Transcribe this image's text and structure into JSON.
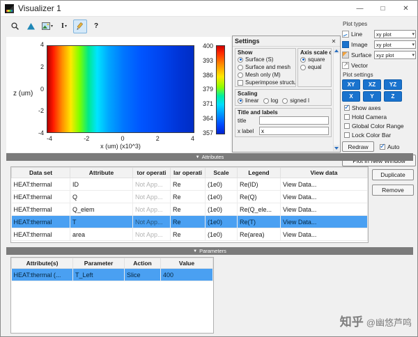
{
  "window": {
    "title": "Visualizer 1"
  },
  "titlebar": {
    "minimize": "—",
    "maximize": "□",
    "close": "✕"
  },
  "toolbar": {
    "text_tool": "I",
    "help": "?"
  },
  "section_glyph": "▼",
  "plot": {
    "ylabel": "z (um)",
    "xlabel": "x (um) (x10^3)",
    "yticks": [
      "4",
      "2",
      "0",
      "-2",
      "-4"
    ],
    "xticks": [
      "-4",
      "-2",
      "0",
      "2",
      "4"
    ],
    "colorbar_ticks": [
      "400",
      "393",
      "386",
      "379",
      "371",
      "364",
      "357"
    ]
  },
  "settings": {
    "title": "Settings",
    "close": "✕",
    "show": {
      "label": "Show",
      "radios": [
        {
          "label": "Surface (S)",
          "selected": true
        },
        {
          "label": "Surface and mesh",
          "selected": false
        },
        {
          "label": "Mesh only (M)",
          "selected": false
        }
      ],
      "superimpose": {
        "label": "Superimpose structure",
        "checked": false
      }
    },
    "axis_scale": {
      "label": "Axis scale opt",
      "radios": [
        {
          "label": "square",
          "selected": true
        },
        {
          "label": "equal",
          "selected": false
        }
      ]
    },
    "scaling": {
      "label": "Scaling",
      "radios": [
        {
          "label": "linear",
          "selected": true
        },
        {
          "label": "log",
          "selected": false
        },
        {
          "label": "signed l",
          "selected": false
        }
      ]
    },
    "labels_group": {
      "label": "Title and labels",
      "fields": [
        {
          "label": "title",
          "value": ""
        },
        {
          "label": "x label",
          "value": "x"
        }
      ]
    }
  },
  "plot_types": {
    "label": "Plot types",
    "rows": [
      {
        "label": "Line",
        "dropdown": "xy plot",
        "selected": false
      },
      {
        "label": "Image",
        "dropdown": "xy plot",
        "selected": true
      },
      {
        "label": "Surface",
        "dropdown": "xyz plot",
        "selected": false
      },
      {
        "label": "Vector",
        "dropdown": "",
        "selected": false
      }
    ]
  },
  "plot_settings": {
    "label": "Plot settings",
    "buttons_row1": [
      "XY",
      "XZ",
      "YZ"
    ],
    "buttons_row2": [
      "X",
      "Y",
      "Z"
    ],
    "checkboxes": [
      {
        "label": "Show axes",
        "checked": true
      },
      {
        "label": "Hold Camera",
        "checked": false
      },
      {
        "label": "Global Color Range",
        "checked": false
      },
      {
        "label": "Lock Color Bar",
        "checked": false
      }
    ],
    "redraw": "Redraw",
    "auto": {
      "label": "Auto",
      "checked": true
    },
    "plot_new_window": "Plot in New Window"
  },
  "attributes": {
    "header": "Attributes",
    "columns": [
      "Data set",
      "Attribute",
      "tor operati",
      "lar operati",
      "Scale",
      "Legend",
      "View data"
    ],
    "rows": [
      {
        "dataset": "HEAT:thermal",
        "attribute": "ID",
        "vector_op": "Not App...",
        "scalar_op": "Re",
        "scale": "(1e0)",
        "legend": "Re(ID)",
        "view": "View Data...",
        "selected": false
      },
      {
        "dataset": "HEAT:thermal",
        "attribute": "Q",
        "vector_op": "Not App...",
        "scalar_op": "Re",
        "scale": "(1e0)",
        "legend": "Re(Q)",
        "view": "View Data...",
        "selected": false
      },
      {
        "dataset": "HEAT:thermal",
        "attribute": "Q_elem",
        "vector_op": "Not App...",
        "scalar_op": "Re",
        "scale": "(1e0)",
        "legend": "Re(Q_ele...",
        "view": "View Data...",
        "selected": false
      },
      {
        "dataset": "HEAT:thermal",
        "attribute": "T",
        "vector_op": "Not App...",
        "scalar_op": "Re",
        "scale": "(1e0)",
        "legend": "Re(T)",
        "view": "View Data...",
        "selected": true
      },
      {
        "dataset": "HEAT:thermal",
        "attribute": "area",
        "vector_op": "Not App...",
        "scalar_op": "Re",
        "scale": "(1e0)",
        "legend": "Re(area)",
        "view": "View Data...",
        "selected": false
      }
    ],
    "buttons": {
      "duplicate": "Duplicate",
      "remove": "Remove"
    }
  },
  "parameters": {
    "header": "Parameters",
    "columns": [
      "Attribute(s)",
      "Parameter",
      "Action",
      "Value"
    ],
    "rows": [
      {
        "attribute": "HEAT:thermal (...",
        "parameter": "T_Left",
        "action": "Slice",
        "value": "400",
        "selected": true
      }
    ]
  },
  "watermark": {
    "brand": "知乎",
    "handle": "@幽悠芦鸣"
  }
}
